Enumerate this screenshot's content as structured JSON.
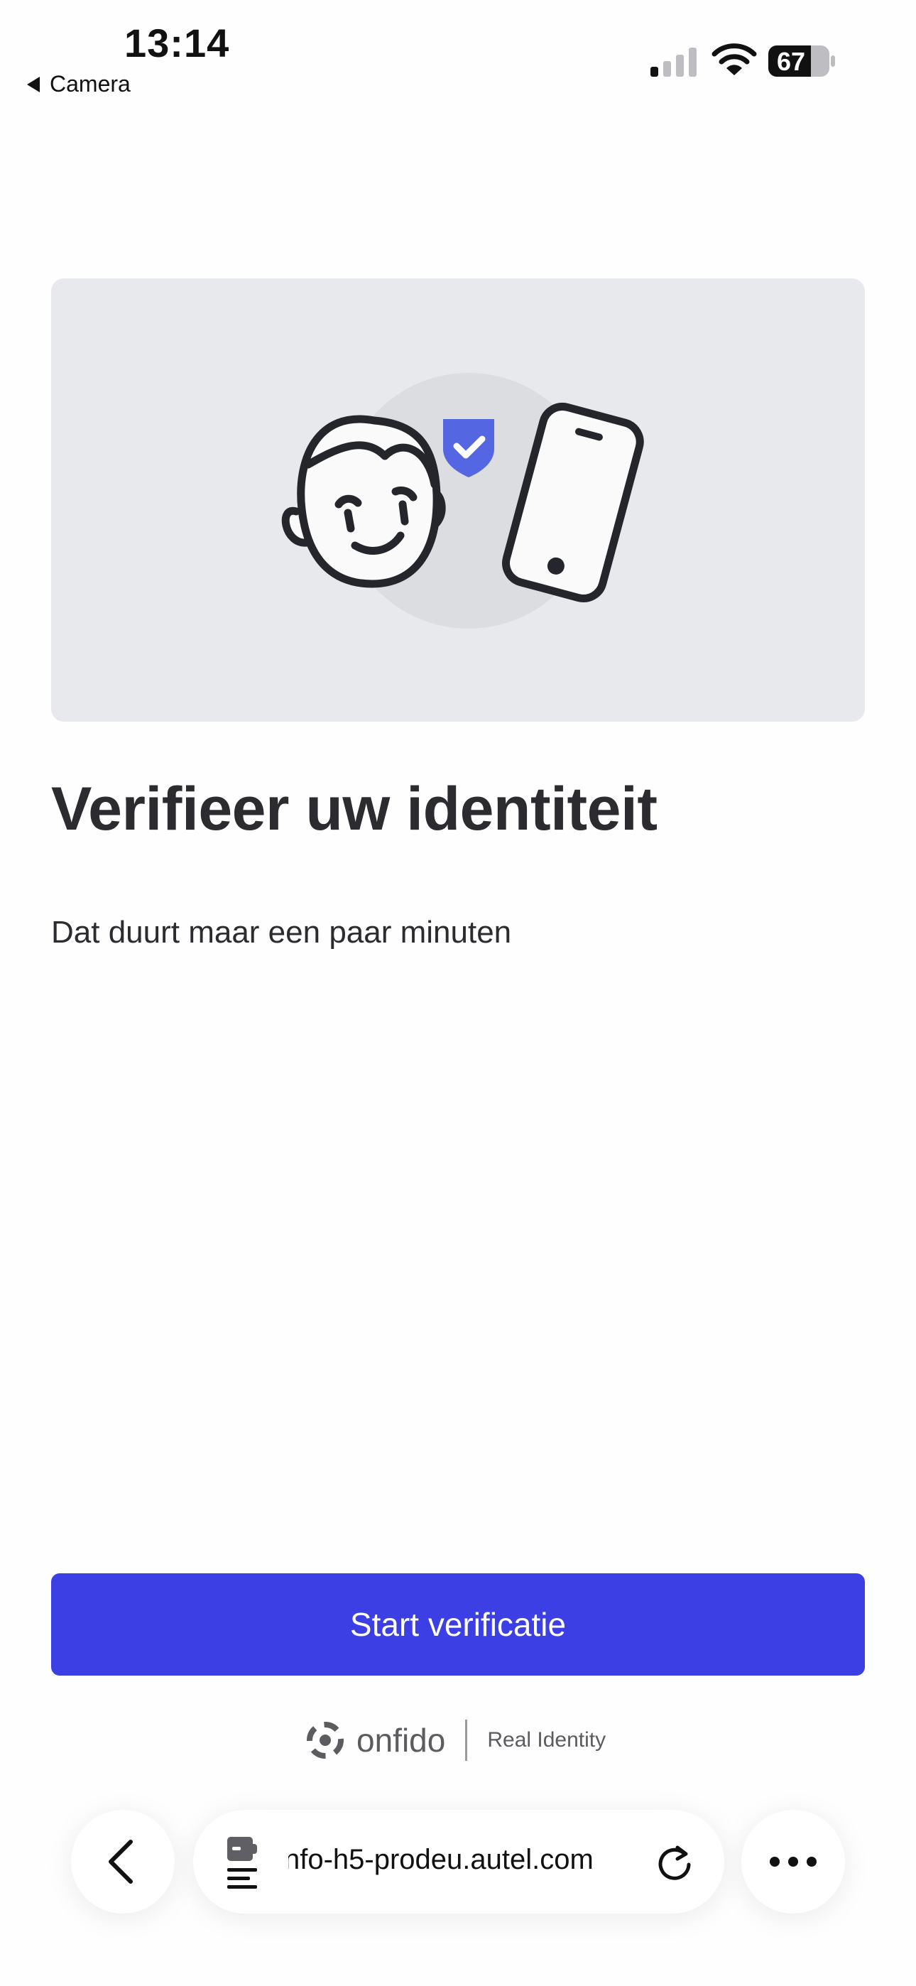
{
  "status_bar": {
    "time": "13:14",
    "back_app_label": "Camera",
    "battery_level": "67",
    "icons": [
      "signal-icon",
      "wifi-icon",
      "battery-icon"
    ]
  },
  "hero": {
    "illustration": [
      "face-icon",
      "shield-check-icon",
      "phone-icon"
    ],
    "colors": {
      "background": "#e8e9ec",
      "shield": "#5566e3"
    }
  },
  "content": {
    "title": "Verifieer uw identiteit",
    "subtitle": "Dat duurt maar een paar minuten"
  },
  "cta": {
    "label": "Start verificatie",
    "color": "#3b3fe4"
  },
  "footer": {
    "brand": "onfido",
    "tagline": "Real Identity"
  },
  "browser": {
    "url": "nfo-h5-prodeu.autel.com",
    "icons": [
      "back-chevron-icon",
      "page-menu-icon",
      "reload-icon",
      "more-icon"
    ]
  }
}
